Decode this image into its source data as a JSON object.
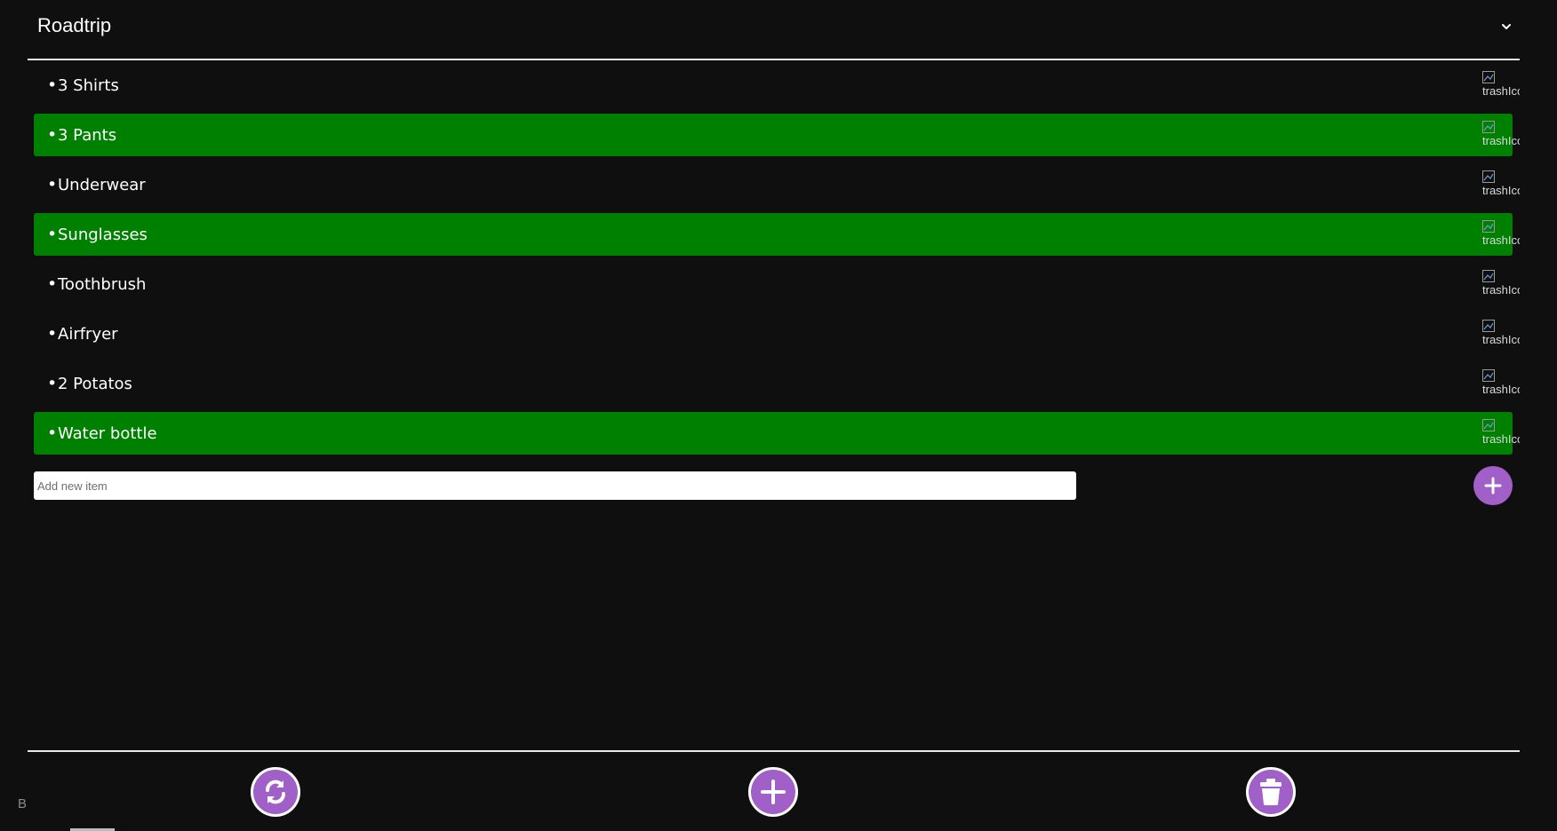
{
  "header": {
    "title": "Roadtrip",
    "dropdown_icon": "chevron-down-icon"
  },
  "items": [
    {
      "text": "3 Shirts",
      "done": false,
      "trash_alt": "trashIcon"
    },
    {
      "text": "3 Pants",
      "done": true,
      "trash_alt": "trashIcon"
    },
    {
      "text": "Underwear",
      "done": false,
      "trash_alt": "trashIcon"
    },
    {
      "text": "Sunglasses",
      "done": true,
      "trash_alt": "trashIcon"
    },
    {
      "text": "Toothbrush",
      "done": false,
      "trash_alt": "trashIcon"
    },
    {
      "text": "Airfryer",
      "done": false,
      "trash_alt": "trashIcon"
    },
    {
      "text": "2 Potatos",
      "done": false,
      "trash_alt": "trashIcon"
    },
    {
      "text": "Water bottle",
      "done": true,
      "trash_alt": "trashIcon"
    }
  ],
  "add_item": {
    "placeholder": "Add new item",
    "value": "",
    "button_icon": "plus-icon"
  },
  "footer": {
    "letter": "B",
    "buttons": [
      {
        "name": "refresh",
        "icon": "refresh-icon"
      },
      {
        "name": "add-list",
        "icon": "plus-icon"
      },
      {
        "name": "delete-list",
        "icon": "trash-icon"
      }
    ]
  },
  "colors": {
    "background": "#0f0f0f",
    "done_item": "#008000",
    "accent": "#a15fc8",
    "divider": "#e8e8e8",
    "text": "#ffffff"
  }
}
